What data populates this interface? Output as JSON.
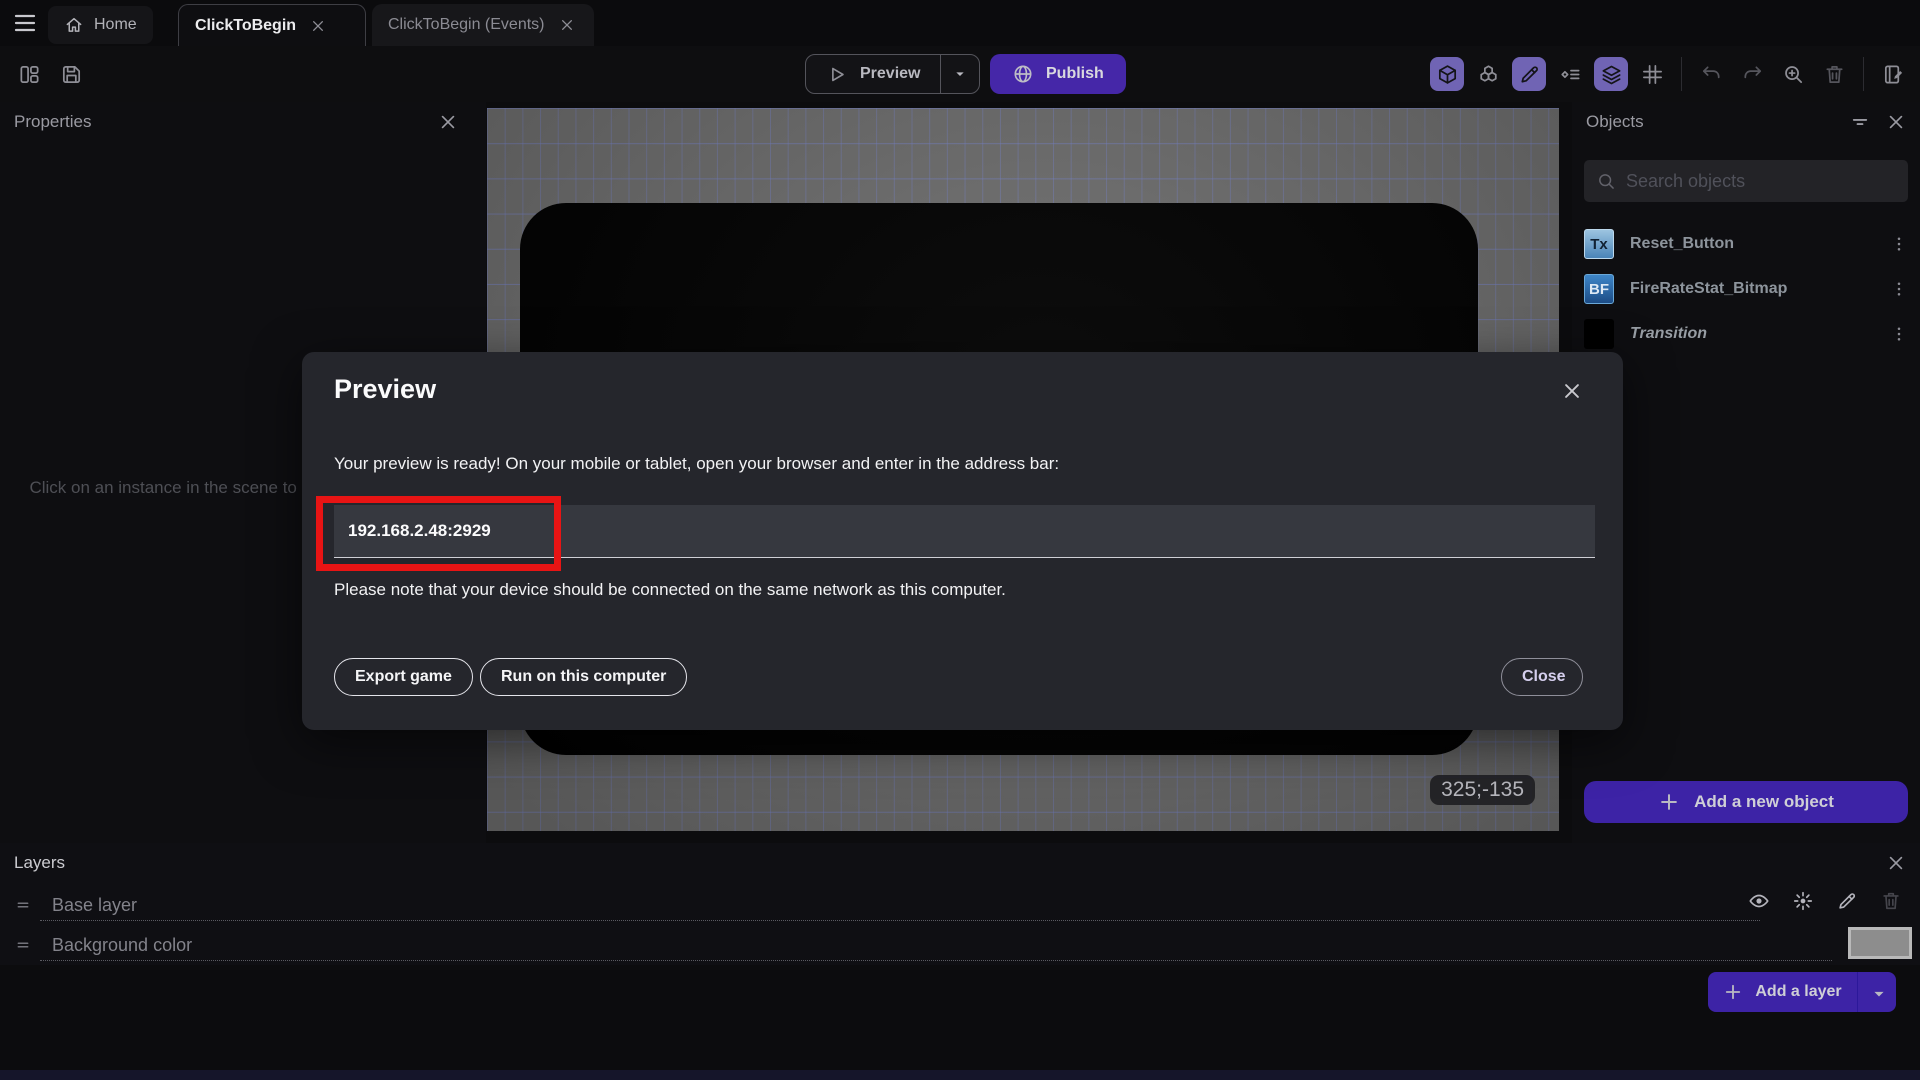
{
  "tabs": {
    "home": "Home",
    "scene": "ClickToBegin",
    "events": "ClickToBegin (Events)"
  },
  "toolbar": {
    "preview_label": "Preview",
    "publish_label": "Publish",
    "left_icon_names": [
      "panels-icon",
      "save-icon"
    ],
    "right_icon_names": [
      "cube-3d-icon",
      "objects-blocks-icon",
      "edit-pencil-icon",
      "instances-list-icon",
      "layers-icon",
      "grid-icon",
      "undo-icon",
      "redo-icon",
      "zoom-in-icon",
      "trash-icon",
      "scene-notes-icon"
    ]
  },
  "properties_panel": {
    "title": "Properties",
    "empty_message": "Click on an instance in the scene to display its properties"
  },
  "canvas": {
    "coordinates_badge": "325;-135"
  },
  "objects_panel": {
    "title": "Objects",
    "search_placeholder": "Search objects",
    "items": [
      {
        "name": "Reset_Button",
        "icon_text": "Tx"
      },
      {
        "name": "FireRateStat_Bitmap",
        "icon_text": "BF"
      },
      {
        "name": "Transition",
        "icon_text": ""
      }
    ],
    "add_button": "Add a new object"
  },
  "dialog": {
    "title": "Preview",
    "message": "Your preview is ready! On your mobile or tablet, open your browser and enter in the address bar:",
    "address": "192.168.2.48:2929",
    "note": "Please note that your device should be connected on the same network as this computer.",
    "buttons": {
      "export": "Export game",
      "run": "Run on this computer",
      "close": "Close"
    }
  },
  "layers_panel": {
    "title": "Layers",
    "layers": [
      {
        "name": "Base layer"
      },
      {
        "name": "Background color"
      }
    ],
    "add_button": "Add a layer"
  },
  "colors": {
    "accent_purple": "#4527a8",
    "toolbar_highlight": "#7064b4",
    "annotation_red": "#e81414",
    "canvas_background": "#6f6f6f",
    "background_color_swatch": "#8d8d8d"
  }
}
